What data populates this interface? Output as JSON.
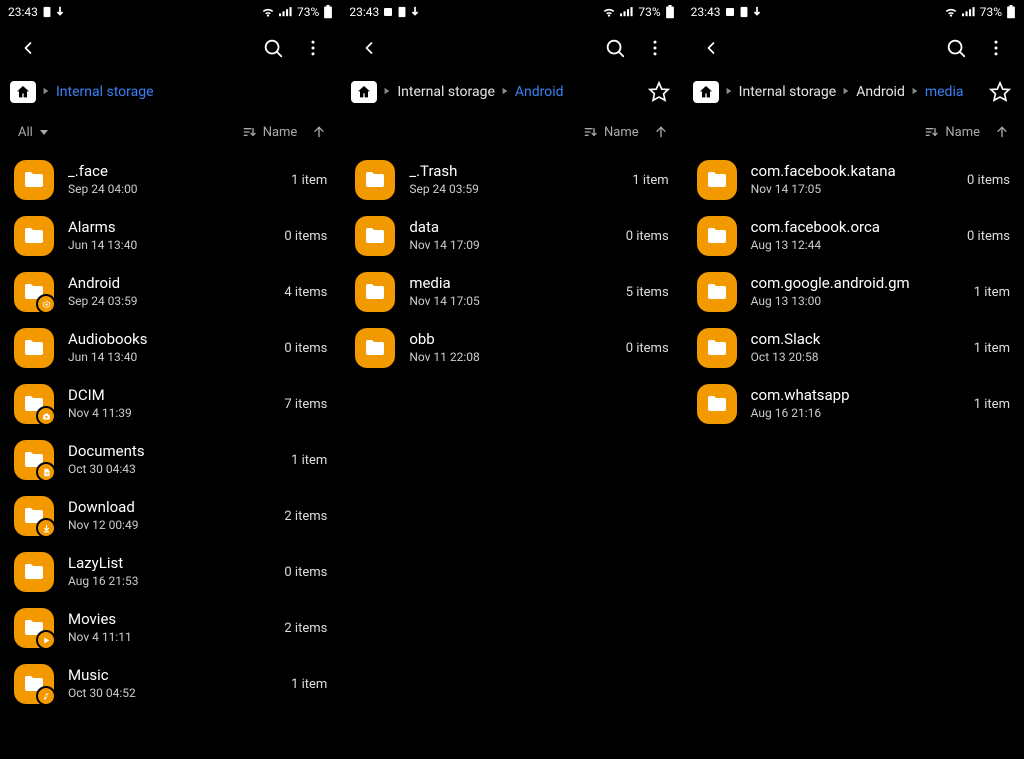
{
  "status": {
    "time": "23:43",
    "battery_text": "73%"
  },
  "sort": {
    "filter_label": "All",
    "sort_label": "Name"
  },
  "screens": [
    {
      "statusExtra": "ab",
      "breadcrumb": [
        {
          "label": "Internal storage",
          "current": true
        }
      ],
      "showStar": false,
      "showFilter": true,
      "items": [
        {
          "name": "_.face",
          "date": "Sep 24 04:00",
          "count": "1 item",
          "badge": null
        },
        {
          "name": "Alarms",
          "date": "Jun 14 13:40",
          "count": "0 items",
          "badge": null
        },
        {
          "name": "Android",
          "date": "Sep 24 03:59",
          "count": "4 items",
          "badge": "gear"
        },
        {
          "name": "Audiobooks",
          "date": "Jun 14 13:40",
          "count": "0 items",
          "badge": null
        },
        {
          "name": "DCIM",
          "date": "Nov 4 11:39",
          "count": "7 items",
          "badge": "camera"
        },
        {
          "name": "Documents",
          "date": "Oct 30 04:43",
          "count": "1 item",
          "badge": "doc"
        },
        {
          "name": "Download",
          "date": "Nov 12 00:49",
          "count": "2 items",
          "badge": "download"
        },
        {
          "name": "LazyList",
          "date": "Aug 16 21:53",
          "count": "0 items",
          "badge": null
        },
        {
          "name": "Movies",
          "date": "Nov 4 11:11",
          "count": "2 items",
          "badge": "play"
        },
        {
          "name": "Music",
          "date": "Oct 30 04:52",
          "count": "1 item",
          "badge": "music"
        }
      ]
    },
    {
      "statusExtra": "cab",
      "breadcrumb": [
        {
          "label": "Internal storage",
          "current": false
        },
        {
          "label": "Android",
          "current": true
        }
      ],
      "showStar": true,
      "showFilter": false,
      "items": [
        {
          "name": "_.Trash",
          "date": "Sep 24 03:59",
          "count": "1 item",
          "badge": null
        },
        {
          "name": "data",
          "date": "Nov 14 17:09",
          "count": "0 items",
          "badge": null
        },
        {
          "name": "media",
          "date": "Nov 14 17:05",
          "count": "5 items",
          "badge": null
        },
        {
          "name": "obb",
          "date": "Nov 11 22:08",
          "count": "0 items",
          "badge": null
        }
      ]
    },
    {
      "statusExtra": "cab",
      "breadcrumb": [
        {
          "label": "Internal storage",
          "current": false
        },
        {
          "label": "Android",
          "current": false
        },
        {
          "label": "media",
          "current": true
        }
      ],
      "showStar": true,
      "showFilter": false,
      "items": [
        {
          "name": "com.facebook.katana",
          "date": "Nov 14 17:05",
          "count": "0 items",
          "badge": null
        },
        {
          "name": "com.facebook.orca",
          "date": "Aug 13 12:44",
          "count": "0 items",
          "badge": null
        },
        {
          "name": "com.google.android.gm",
          "date": "Aug 13 13:00",
          "count": "1 item",
          "badge": null
        },
        {
          "name": "com.Slack",
          "date": "Oct 13 20:58",
          "count": "1 item",
          "badge": null
        },
        {
          "name": "com.whatsapp",
          "date": "Aug 16 21:16",
          "count": "1 item",
          "badge": null
        }
      ]
    }
  ]
}
